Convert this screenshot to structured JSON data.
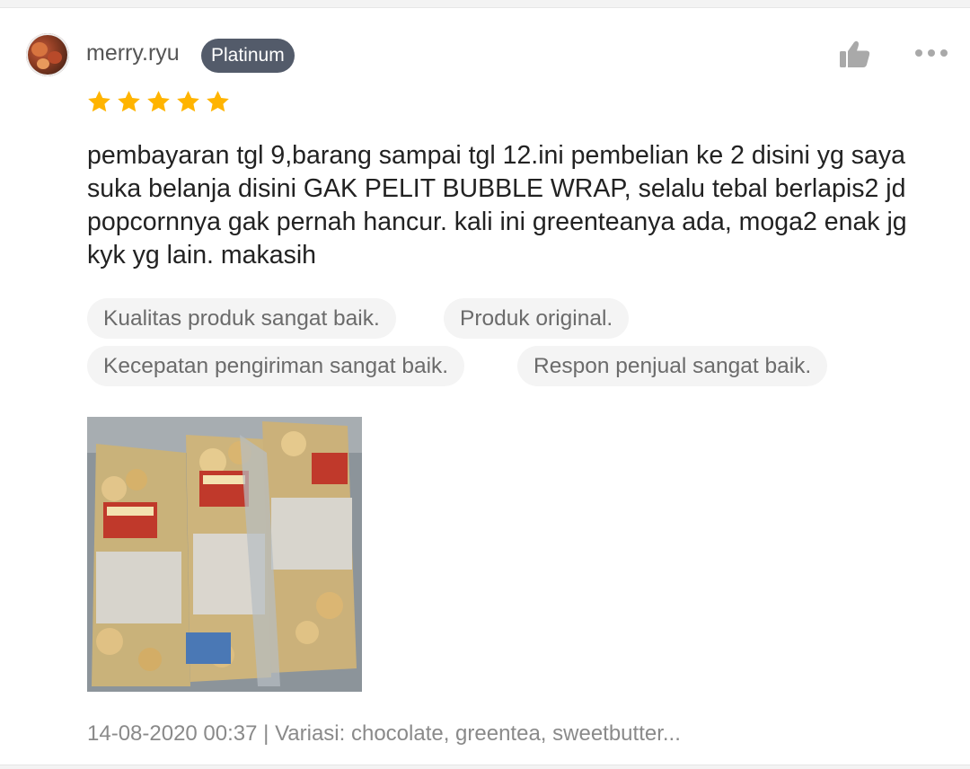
{
  "review": {
    "username": "merry.ryu",
    "badge": "Platinum",
    "rating": 5,
    "star_color": "#ffb400",
    "text": "pembayaran tgl 9,barang sampai tgl 12.ini pembelian ke 2 disini yg saya suka belanja disini GAK PELIT BUBBLE WRAP, selalu tebal berlapis2 jd popcornnya gak pernah hancur. kali ini greenteanya ada, moga2 enak jg kyk yg lain. makasih",
    "tags": [
      "Kualitas produk sangat baik.",
      "Produk original.",
      "Kecepatan pengiriman sangat baik.",
      "Respon penjual sangat baik."
    ],
    "footer": "14-08-2020 00:37 | Variasi: chocolate, greentea, sweetbutter...",
    "icons": [
      "thumbs-up-icon",
      "more-options-icon",
      "star-icon"
    ]
  }
}
